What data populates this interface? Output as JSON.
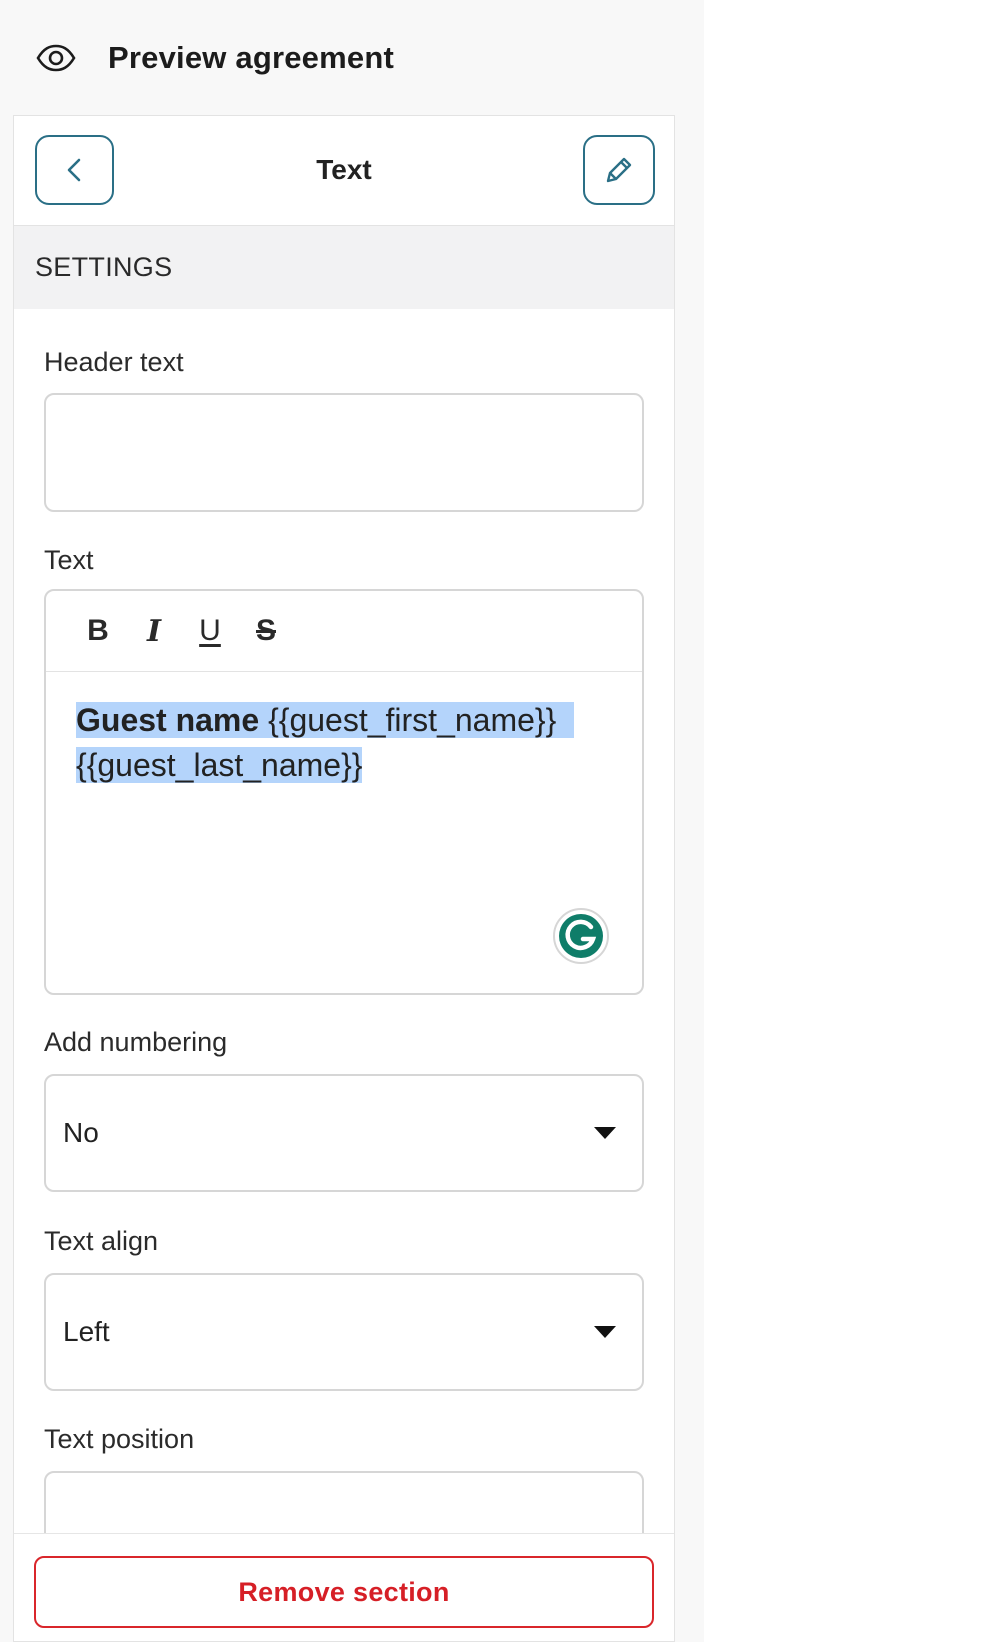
{
  "topbar": {
    "title": "Preview agreement",
    "icon": "eye-icon"
  },
  "panel": {
    "title": "Text",
    "back_icon": "chevron-left-icon",
    "edit_icon": "pencil-icon",
    "section_label": "SETTINGS"
  },
  "fields": {
    "header_text": {
      "label": "Header text",
      "value": ""
    },
    "text": {
      "label": "Text",
      "toolbar": {
        "bold": "B",
        "italic": "I",
        "underline": "U",
        "strike": "S"
      },
      "content_bold": "Guest name",
      "content_line1": " {{guest_first_name}}",
      "content_line2": "{{guest_last_name}}"
    },
    "add_numbering": {
      "label": "Add numbering",
      "value": "No"
    },
    "text_align": {
      "label": "Text align",
      "value": "Left"
    },
    "text_position": {
      "label": "Text position"
    }
  },
  "footer": {
    "remove_label": "Remove section"
  },
  "colors": {
    "accent": "#2a6f86",
    "danger": "#d61f26",
    "selection": "#b4d4fb",
    "grammarly": "#0f7d69"
  }
}
